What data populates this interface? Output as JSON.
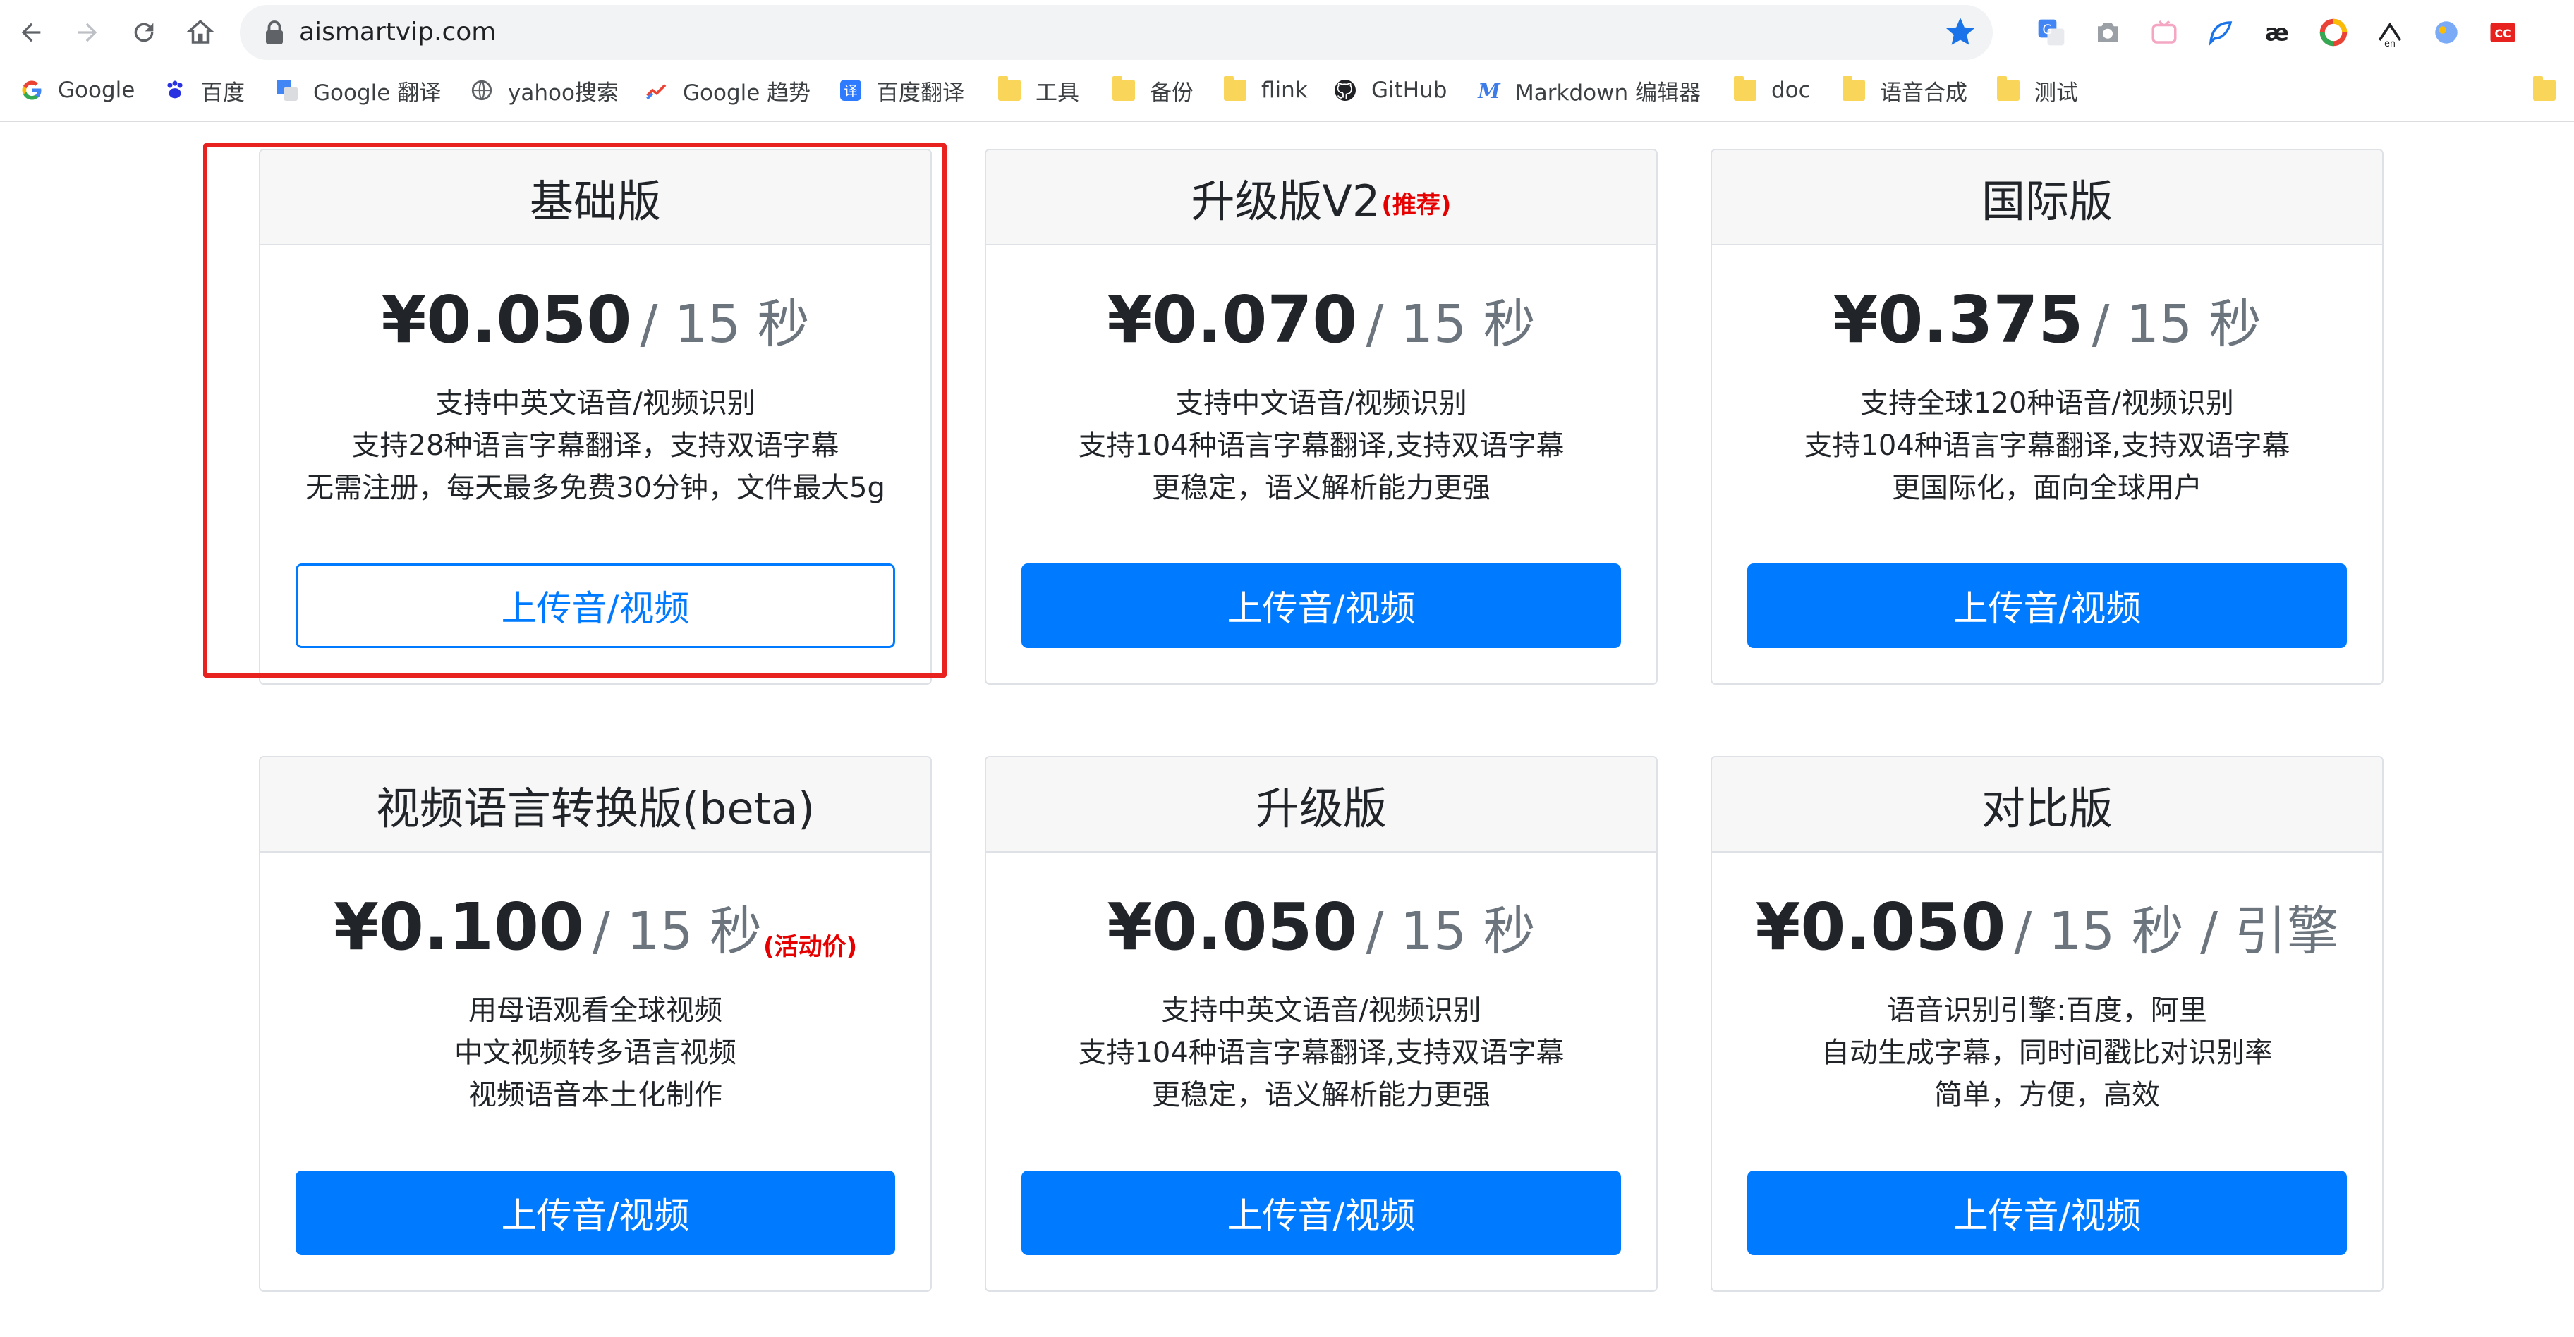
{
  "browser": {
    "url": "aismartvip.com",
    "bookmarks": [
      {
        "label": "Google",
        "icon": "google-icon"
      },
      {
        "label": "百度",
        "icon": "baidu-paw-icon"
      },
      {
        "label": "Google 翻译",
        "icon": "google-translate-icon"
      },
      {
        "label": "yahoo搜索",
        "icon": "globe-icon"
      },
      {
        "label": "Google 趋势",
        "icon": "trends-icon"
      },
      {
        "label": "百度翻译",
        "icon": "baidu-translate-icon"
      },
      {
        "label": "工具",
        "icon": "folder-icon"
      },
      {
        "label": "备份",
        "icon": "folder-icon"
      },
      {
        "label": "flink",
        "icon": "folder-icon"
      },
      {
        "label": "GitHub",
        "icon": "github-icon"
      },
      {
        "label": "Markdown 编辑器",
        "icon": "markdown-icon"
      },
      {
        "label": "doc",
        "icon": "folder-icon"
      },
      {
        "label": "语音合成",
        "icon": "folder-icon"
      },
      {
        "label": "测试",
        "icon": "folder-icon"
      }
    ]
  },
  "plans": [
    {
      "title": "基础版",
      "title_badge": "",
      "price": "¥0.050",
      "unit": "/ 15 秒",
      "unit_badge": "",
      "features": [
        "支持中英文语音/视频识别",
        "支持28种语言字幕翻译，支持双语字幕",
        "无需注册，每天最多免费30分钟，文件最大5g"
      ],
      "button": "上传音/视频",
      "button_style": "outline",
      "highlighted": true
    },
    {
      "title": "升级版V2",
      "title_badge": "(推荐)",
      "price": "¥0.070",
      "unit": "/ 15 秒",
      "unit_badge": "",
      "features": [
        "支持中文语音/视频识别",
        "支持104种语言字幕翻译,支持双语字幕",
        "更稳定，语义解析能力更强"
      ],
      "button": "上传音/视频",
      "button_style": "solid",
      "highlighted": false
    },
    {
      "title": "国际版",
      "title_badge": "",
      "price": "¥0.375",
      "unit": "/ 15 秒",
      "unit_badge": "",
      "features": [
        "支持全球120种语音/视频识别",
        "支持104种语言字幕翻译,支持双语字幕",
        "更国际化，面向全球用户"
      ],
      "button": "上传音/视频",
      "button_style": "solid",
      "highlighted": false
    },
    {
      "title": "视频语言转换版(beta)",
      "title_badge": "",
      "price": "¥0.100",
      "unit": "/ 15 秒",
      "unit_badge": "(活动价)",
      "features": [
        "用母语观看全球视频",
        "中文视频转多语言视频",
        "视频语音本土化制作"
      ],
      "button": "上传音/视频",
      "button_style": "solid",
      "highlighted": false
    },
    {
      "title": "升级版",
      "title_badge": "",
      "price": "¥0.050",
      "unit": "/ 15 秒",
      "unit_badge": "",
      "features": [
        "支持中英文语音/视频识别",
        "支持104种语言字幕翻译,支持双语字幕",
        "更稳定，语义解析能力更强"
      ],
      "button": "上传音/视频",
      "button_style": "solid",
      "highlighted": false
    },
    {
      "title": "对比版",
      "title_badge": "",
      "price": "¥0.050",
      "unit": "/ 15 秒 / 引擎",
      "unit_badge": "",
      "features": [
        "语音识别引擎:百度，阿里",
        "自动生成字幕，同时间戳比对识别率",
        "简单，方便，高效"
      ],
      "button": "上传音/视频",
      "button_style": "solid",
      "highlighted": false
    }
  ],
  "colors": {
    "primary": "#007bff",
    "highlight_border": "#e8231f",
    "badge_red": "#e60000",
    "header_bg": "#f7f7f7"
  }
}
